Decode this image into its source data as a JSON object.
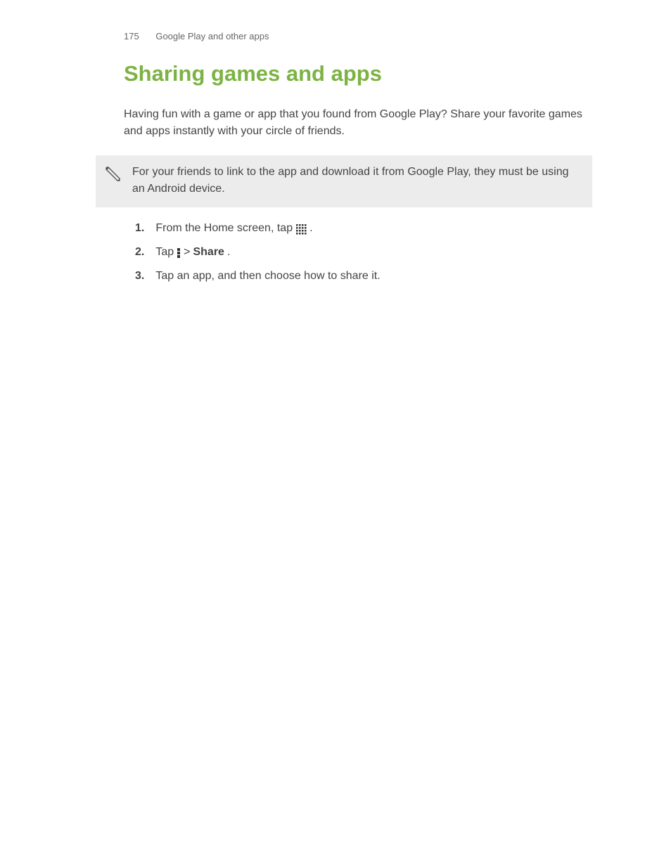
{
  "header": {
    "page_number": "175",
    "section": "Google Play and other apps"
  },
  "title": "Sharing games and apps",
  "intro": "Having fun with a game or app that you found from Google Play? Share your favorite games and apps instantly with your circle of friends.",
  "note": "For your friends to link to the app and download it from Google Play, they must be using an Android device.",
  "steps": {
    "s1": {
      "num": "1.",
      "pre": "From the Home screen, tap ",
      "post": "."
    },
    "s2": {
      "num": "2.",
      "pre": "Tap ",
      "sep": " > ",
      "share": "Share",
      "post": "."
    },
    "s3": {
      "num": "3.",
      "text": "Tap an app, and then choose how to share it."
    }
  }
}
